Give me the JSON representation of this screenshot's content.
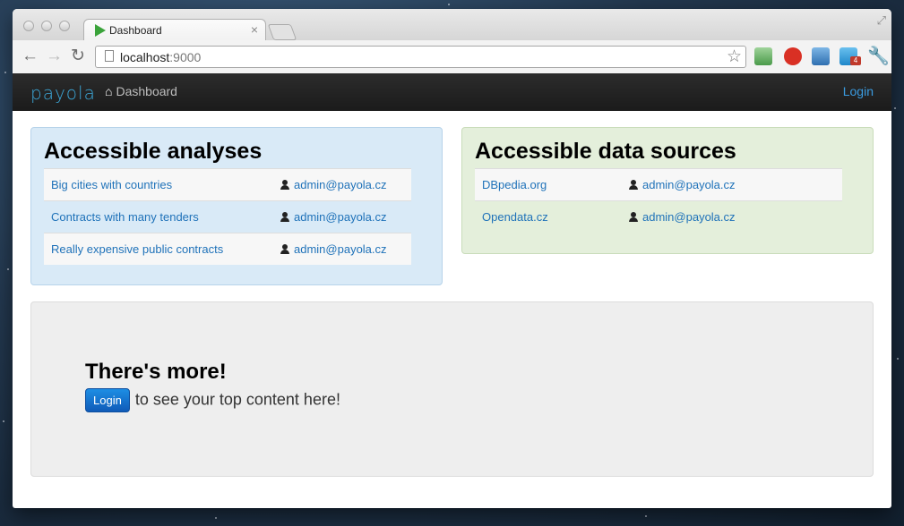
{
  "browser": {
    "tab_title": "Dashboard",
    "tab_close": "×",
    "url_host": "localhost",
    "url_port": ":9000",
    "ext_badge": "4"
  },
  "navbar": {
    "brand": "payola",
    "dashboard": "Dashboard",
    "login": "Login"
  },
  "analyses": {
    "title": "Accessible analyses",
    "rows": [
      {
        "name": "Big cities with countries",
        "owner": "admin@payola.cz"
      },
      {
        "name": "Contracts with many tenders",
        "owner": "admin@payola.cz"
      },
      {
        "name": "Really expensive public contracts",
        "owner": "admin@payola.cz"
      }
    ]
  },
  "data_sources": {
    "title": "Accessible data sources",
    "rows": [
      {
        "name": "DBpedia.org",
        "owner": "admin@payola.cz"
      },
      {
        "name": "Opendata.cz",
        "owner": "admin@payola.cz"
      }
    ]
  },
  "more": {
    "title": "There's more!",
    "button": "Login",
    "text": "to see your top content here!"
  },
  "colors": {
    "analyses_bg": "#d9eaf7",
    "analyses_border": "#b7d3ea",
    "sources_bg": "#e4efdb",
    "sources_border": "#c9dcba",
    "more_bg": "#eeeeee",
    "link": "#1f72b9",
    "brand": "#3ca7d8"
  }
}
